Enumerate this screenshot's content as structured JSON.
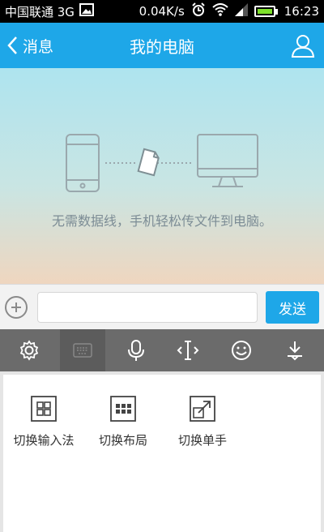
{
  "status_bar": {
    "carrier": "中国联通 3G",
    "speed": "0.04K/s",
    "time": "16:23"
  },
  "header": {
    "back_label": "消息",
    "title": "我的电脑"
  },
  "main": {
    "hint": "无需数据线，手机轻松传文件到电脑。"
  },
  "input_bar": {
    "send_label": "发送",
    "placeholder": ""
  },
  "keyboard_toolbar": {
    "active_index": 1,
    "items": [
      "gear-icon",
      "keyboard-icon",
      "microphone-icon",
      "cursor-icon",
      "emoji-icon",
      "collapse-icon"
    ]
  },
  "panel": {
    "options": [
      {
        "label": "切换输入法",
        "icon": "grid-2x2-icon"
      },
      {
        "label": "切换布局",
        "icon": "grid-3x2-icon"
      },
      {
        "label": "切换单手",
        "icon": "expand-arrow-icon"
      }
    ]
  },
  "colors": {
    "primary": "#1ea7e8",
    "toolbar": "#6b6b6b",
    "battery": "#7ee02b"
  }
}
